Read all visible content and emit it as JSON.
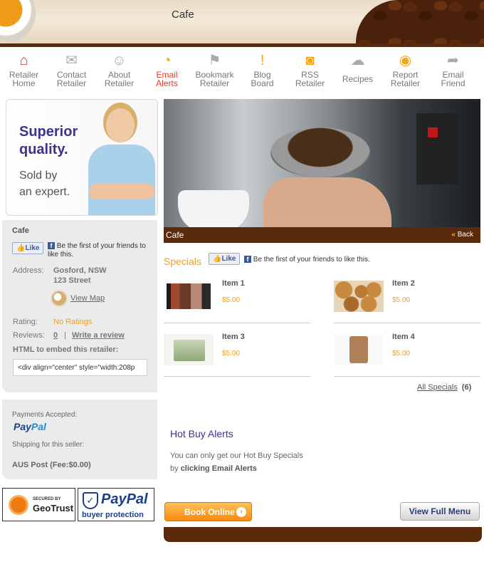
{
  "header": {
    "title": "Cafe"
  },
  "nav": [
    {
      "line1": "Retailer",
      "line2": "Home",
      "icon": "home-icon"
    },
    {
      "line1": "Contact",
      "line2": "Retailer",
      "icon": "chat-icon"
    },
    {
      "line1": "About",
      "line2": "Retailer",
      "icon": "people-icon"
    },
    {
      "line1": "Email",
      "line2": "Alerts",
      "icon": "alert-icon"
    },
    {
      "line1": "Bookmark",
      "line2": "Retailer",
      "icon": "bookmark-icon"
    },
    {
      "line1": "Blog",
      "line2": "Board",
      "icon": "blog-icon"
    },
    {
      "line1": "RSS",
      "line2": "Retailer",
      "icon": "rss-icon"
    },
    {
      "line1": "Recipes",
      "line2": "",
      "icon": "chef-hat-icon"
    },
    {
      "line1": "Report",
      "line2": "Retailer",
      "icon": "report-icon"
    },
    {
      "line1": "Email",
      "line2": "Friend",
      "icon": "email-friend-icon"
    }
  ],
  "promo": {
    "headline1": "Superior",
    "headline2": "quality.",
    "sub1": "Sold by",
    "sub2": "an expert."
  },
  "retailer": {
    "name": "Cafe",
    "like_label": "Like",
    "like_text": "Be the first of your friends to like this.",
    "address_label": "Address:",
    "address_line1": "Gosford, NSW",
    "address_line2": "123 Street",
    "view_map": "View Map",
    "rating_label": "Rating:",
    "rating_value": "No Ratings",
    "reviews_label": "Reviews:",
    "reviews_count": "0",
    "reviews_sep": "|",
    "write_review": "Write a review",
    "embed_label": "HTML to embed this retailer:",
    "embed_value": "<div align=\"center\" style=\"width:208p"
  },
  "payments": {
    "accepted_label": "Payments Accepted:",
    "paypal_a": "Pay",
    "paypal_b": "Pal",
    "shipping_label": "Shipping for this seller:",
    "shipping_value": "AUS Post (Fee:$0.00)"
  },
  "badges": {
    "geotrust_top": "SECURED BY",
    "geotrust_name": "GeoTrust",
    "paypal_name": "PayPal",
    "paypal_sub": "buyer protection"
  },
  "hero": {
    "caption": "Cafe",
    "back_arrows": "«",
    "back_label": "Back"
  },
  "specials": {
    "title": "Specials",
    "like_label": "Like",
    "like_text": "Be the first of your friends to like this.",
    "items": [
      {
        "name": "Item 1",
        "price": "$5.00"
      },
      {
        "name": "Item 2",
        "price": "$5.00"
      },
      {
        "name": "Item 3",
        "price": "$5.00"
      },
      {
        "name": "Item 4",
        "price": "$5.00"
      }
    ],
    "all_label": "All Specials",
    "all_count": "(6)"
  },
  "hotbuy": {
    "title": "Hot Buy Alerts",
    "line1": "You can only get our Hot Buy Specials",
    "line2_prefix": "by ",
    "line2_bold": "clicking Email Alerts"
  },
  "buttons": {
    "book_online": "Book Online",
    "view_menu": "View Full Menu"
  },
  "colors": {
    "brown": "#5a2a0c",
    "orange": "#f0a020",
    "navy": "#3b3391"
  }
}
